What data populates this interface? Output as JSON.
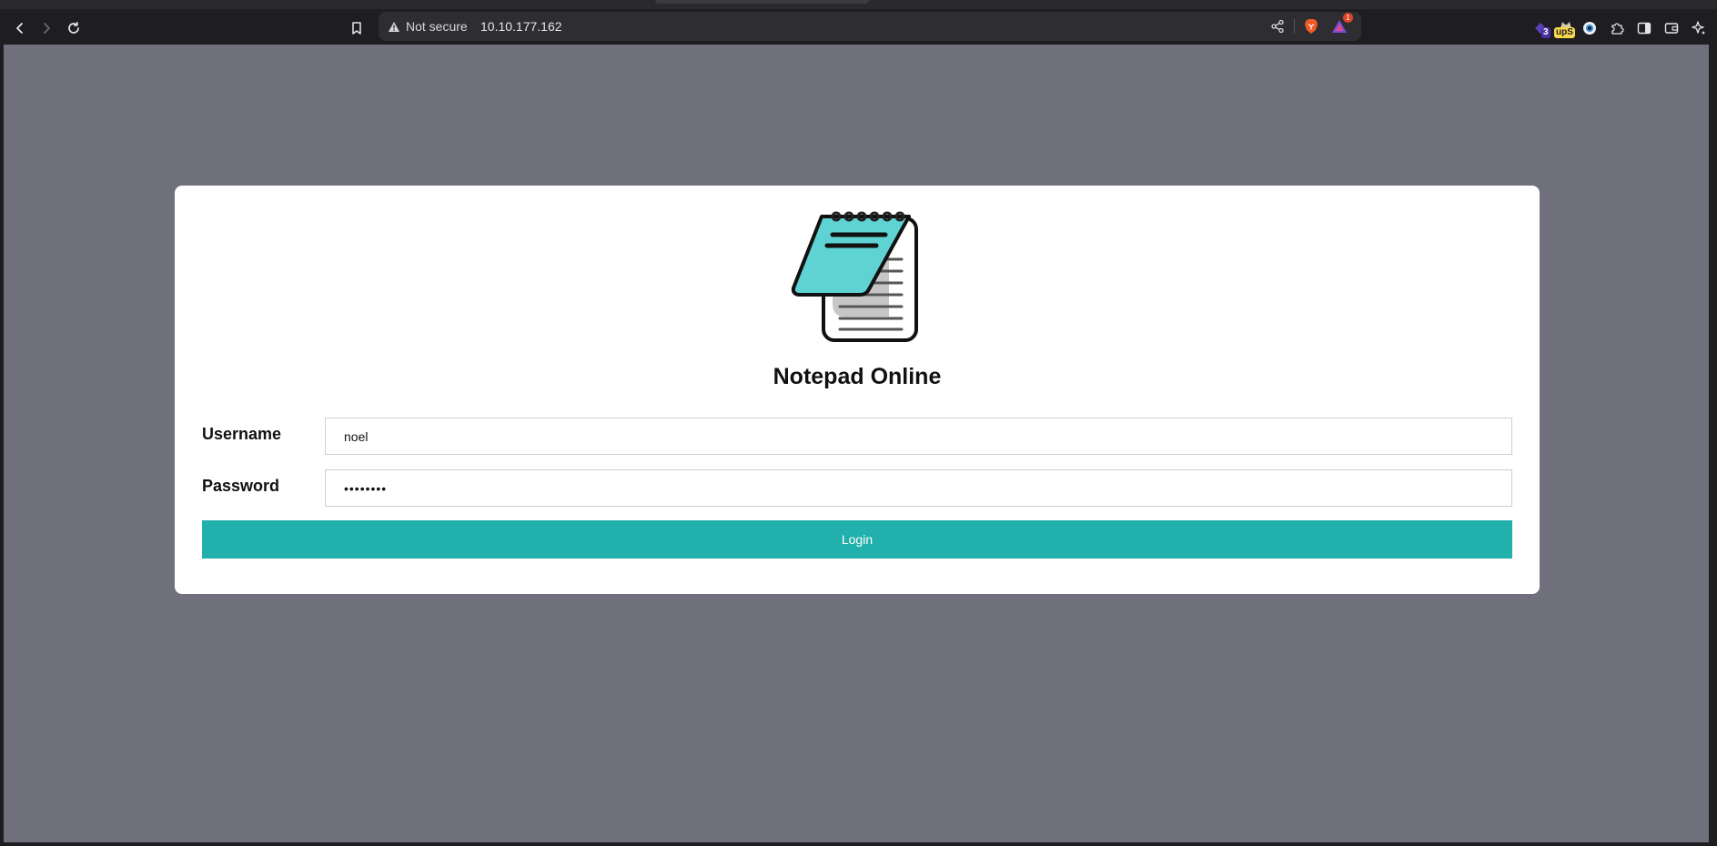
{
  "browser": {
    "security_label": "Not secure",
    "url": "10.10.177.162",
    "notification_count": "1",
    "extension_badge_count": "3",
    "extension_badge_text": "upS"
  },
  "colors": {
    "page_background": "#70707c",
    "login_button": "#21b0ac",
    "logo_cover": "#5fd3d3"
  },
  "login": {
    "app_title": "Notepad Online",
    "username_label": "Username",
    "username_value": "noel",
    "password_label": "Password",
    "password_value": "••••••••",
    "submit_label": "Login"
  }
}
